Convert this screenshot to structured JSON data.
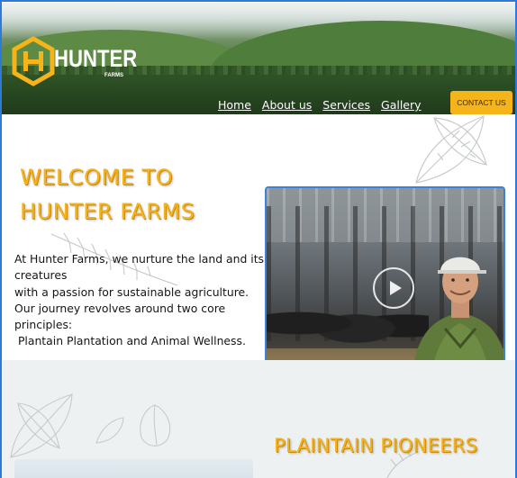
{
  "brand": {
    "name": "HUNTER",
    "sub": "FARMS",
    "accent": "#f4b41a"
  },
  "nav": {
    "items": [
      "Home",
      "About us",
      "Services",
      "Gallery"
    ],
    "cta": "CONTACT US"
  },
  "welcome": {
    "title_line1": "WELCOME TO",
    "title_line2": "HUNTER FARMS",
    "lines": [
      "At Hunter Farms, we nurture the land and its",
      "creatures",
      "with a passion for sustainable agriculture.",
      "Our journey revolves around two core",
      "principles:",
      " Plantain Plantation and Animal Wellness."
    ],
    "video": {
      "icon": "play-icon"
    }
  },
  "section2": {
    "title": "PLAINTAIN PIONEERS"
  },
  "colors": {
    "heading": "#f5b31b",
    "frame": "#2f7ad9",
    "lower_bg": "#edf1f1"
  }
}
